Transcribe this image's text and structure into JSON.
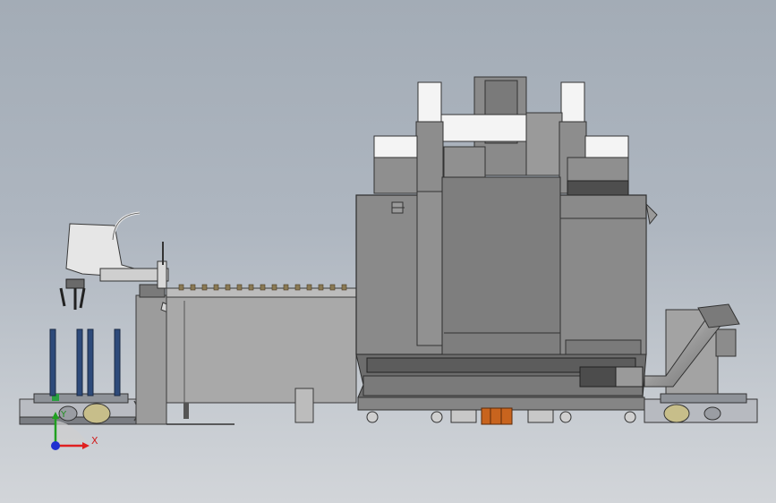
{
  "triad": {
    "x_label": "X",
    "y_label": "Y",
    "x_color": "#e02020",
    "y_color": "#20a020",
    "z_color": "#2030d0"
  },
  "colors": {
    "background_top": "#a3acb6",
    "background_bottom": "#d2d5d9",
    "machine_dark": "#6a6a6a",
    "machine_mid": "#8a8a8a",
    "machine_light": "#9c9c9c",
    "highlight_white": "#f4f4f4",
    "blue_posts": "#2d4a7a",
    "orange_block": "#c8641e"
  }
}
